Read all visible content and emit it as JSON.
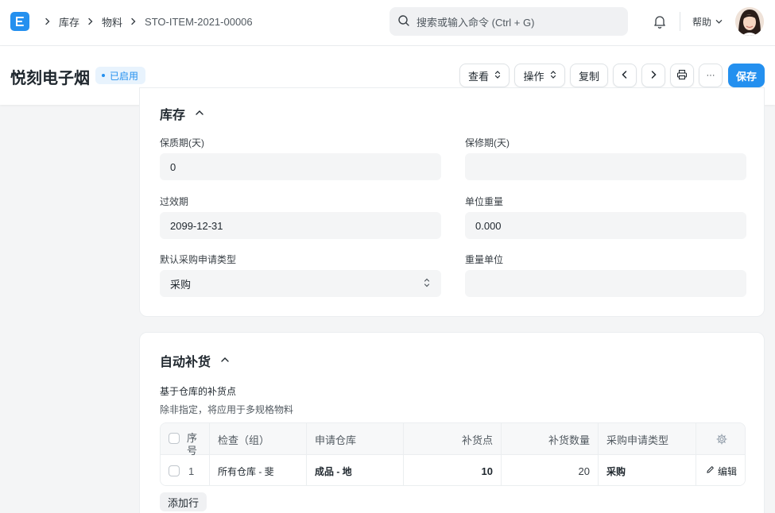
{
  "breadcrumbs": [
    "库存",
    "物料",
    "STO-ITEM-2021-00006"
  ],
  "search": {
    "placeholder": "搜索或输入命令 (Ctrl + G)"
  },
  "navbar": {
    "help_label": "帮助"
  },
  "page": {
    "title": "悦刻电子烟",
    "status": "已启用"
  },
  "actions": {
    "view": "查看",
    "operate": "操作",
    "copy": "复制",
    "more": "···",
    "save": "保存"
  },
  "colors": {
    "primary": "#2490ef",
    "badge_bg": "#e8f3fd"
  },
  "inventory": {
    "title": "库存",
    "shelf_life_label": "保质期(天)",
    "shelf_life_value": "0",
    "warranty_label": "保修期(天)",
    "warranty_value": "",
    "expiry_label": "过效期",
    "expiry_value": "2099-12-31",
    "unit_weight_label": "单位重量",
    "unit_weight_value": "0.000",
    "mr_type_label": "默认采购申请类型",
    "mr_type_value": "采购",
    "weight_uom_label": "重量单位",
    "weight_uom_value": ""
  },
  "reorder": {
    "title": "自动补货",
    "subtitle": "基于仓库的补货点",
    "description": "除非指定，将应用于多规格物料",
    "columns": [
      "序号",
      "检查（组）",
      "申请仓库",
      "补货点",
      "补货数量",
      "采购申请类型"
    ],
    "rows": [
      {
        "idx": "1",
        "check_group": "所有仓库 - 斐",
        "warehouse": "成品 - 地",
        "reorder_level": "10",
        "reorder_qty": "20",
        "mr_type": "采购",
        "edit": "编辑"
      }
    ],
    "add_row": "添加行"
  }
}
